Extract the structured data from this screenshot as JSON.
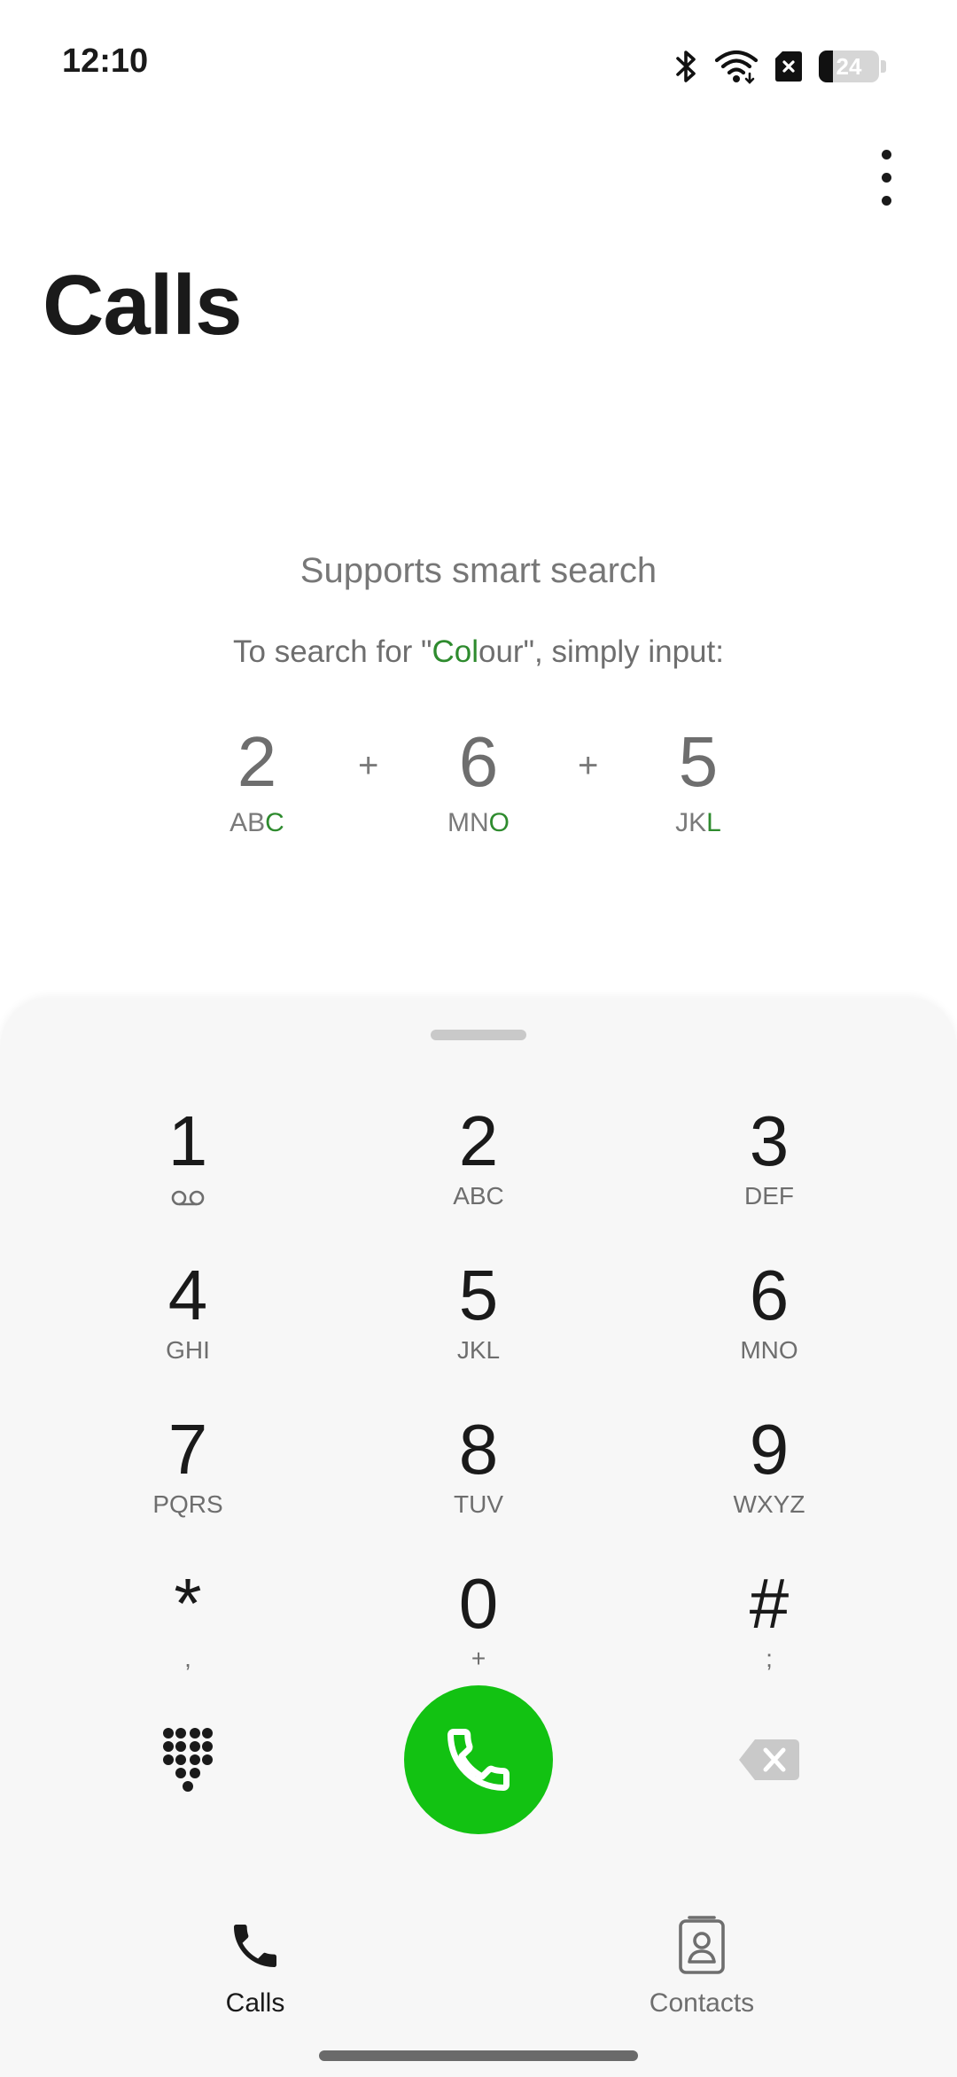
{
  "status_bar": {
    "time": "12:10",
    "battery_percent": "24",
    "icons": [
      "bluetooth-icon",
      "wifi-icon",
      "no-sim-icon",
      "battery-icon"
    ]
  },
  "header": {
    "title": "Calls",
    "more_icon": "more-vertical-icon"
  },
  "smart_search": {
    "title": "Supports smart search",
    "subtitle_prefix": "To search for \"",
    "subtitle_highlight": "Col",
    "subtitle_rest": "our\", simply input:",
    "plus": "+",
    "keys": [
      {
        "digit": "2",
        "letters_plain": "AB",
        "letters_highlight": "C"
      },
      {
        "digit": "6",
        "letters_plain": "MN",
        "letters_highlight": "O"
      },
      {
        "digit": "5",
        "letters_plain": "JK",
        "letters_highlight": "L"
      }
    ]
  },
  "dialpad": {
    "keys": [
      {
        "digit": "1",
        "sub": ""
      },
      {
        "digit": "2",
        "sub": "ABC"
      },
      {
        "digit": "3",
        "sub": "DEF"
      },
      {
        "digit": "4",
        "sub": "GHI"
      },
      {
        "digit": "5",
        "sub": "JKL"
      },
      {
        "digit": "6",
        "sub": "MNO"
      },
      {
        "digit": "7",
        "sub": "PQRS"
      },
      {
        "digit": "8",
        "sub": "TUV"
      },
      {
        "digit": "9",
        "sub": "WXYZ"
      },
      {
        "digit": "*",
        "sub": ","
      },
      {
        "digit": "0",
        "sub": "+"
      },
      {
        "digit": "#",
        "sub": ";"
      }
    ],
    "voicemail_icon": "voicemail-icon",
    "keypad_icon": "dialpad-grid-icon",
    "call_icon": "phone-icon",
    "backspace_icon": "backspace-icon",
    "call_color": "#12c212"
  },
  "bottom_nav": {
    "items": [
      {
        "label": "Calls",
        "icon": "phone-icon",
        "active": true
      },
      {
        "label": "Contacts",
        "icon": "contacts-icon",
        "active": false
      }
    ]
  }
}
